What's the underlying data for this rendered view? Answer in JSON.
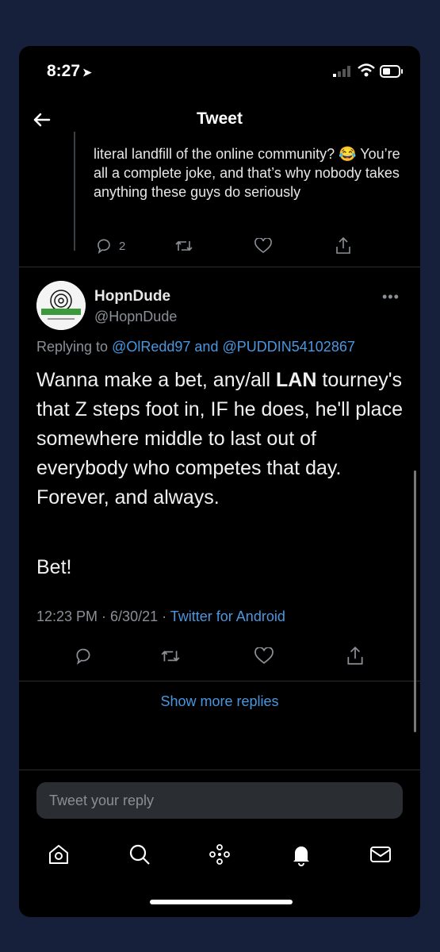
{
  "status_bar": {
    "time": "8:27",
    "location_arrow": "location-arrow-icon"
  },
  "header": {
    "title": "Tweet",
    "back_icon": "back-arrow-icon"
  },
  "previous_tweet": {
    "text": "literal landfill of the online community? 😂 You’re all a complete joke, and that’s why nobody takes anything these guys do seriously",
    "reply_count": "2"
  },
  "main_tweet": {
    "display_name": "HopnDude",
    "handle": "@HopnDude",
    "more_label": "•••",
    "replying_prefix": "Replying to",
    "replying_mention1": "@OlRedd97",
    "replying_and": "and",
    "replying_mention2": "@PUDDIN54102867",
    "body_part1": "Wanna make a bet, any/all",
    "body_bold": "LAN",
    "body_part2": "tourney's that Z steps foot in, IF he does, he'll place somewhere middle to last out of everybody who competes that day. Forever, and always.",
    "body_last": "Bet!",
    "timestamp": "12:23 PM · 6/30/21 ·",
    "source": "Twitter for Android"
  },
  "show_more": "Show more replies",
  "reply_box": {
    "placeholder": "Tweet your reply"
  },
  "bottom_nav": [
    "home-icon",
    "search-icon",
    "spaces-icon",
    "notifications-icon",
    "messages-icon"
  ],
  "colors": {
    "background": "#000000",
    "link": "#4a97e0",
    "muted": "#8b9097",
    "frame": "#16203a"
  }
}
